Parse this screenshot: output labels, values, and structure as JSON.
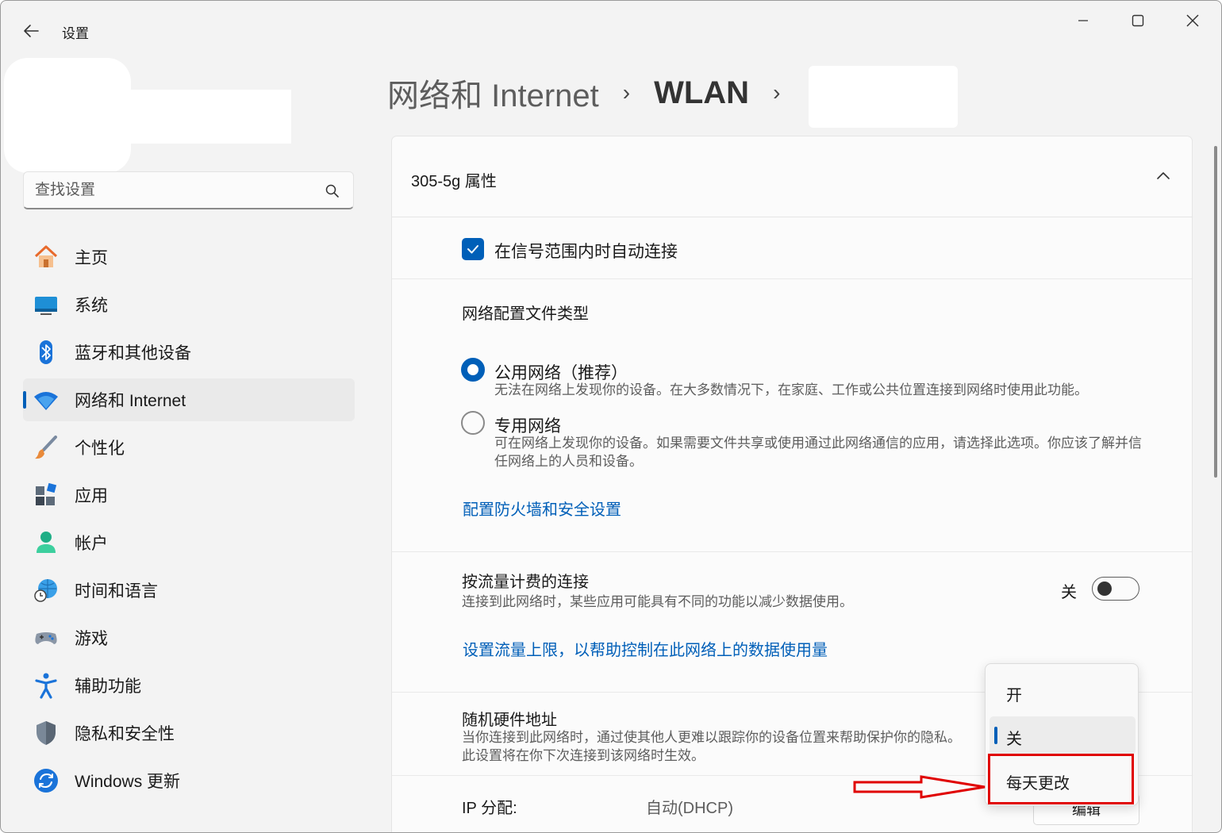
{
  "window": {
    "title": "设置"
  },
  "search": {
    "placeholder": "查找设置"
  },
  "sidebar": {
    "items": [
      {
        "label": "主页",
        "icon": "home-icon"
      },
      {
        "label": "系统",
        "icon": "system-icon"
      },
      {
        "label": "蓝牙和其他设备",
        "icon": "bluetooth-icon"
      },
      {
        "label": "网络和 Internet",
        "icon": "wifi-icon"
      },
      {
        "label": "个性化",
        "icon": "brush-icon"
      },
      {
        "label": "应用",
        "icon": "apps-icon"
      },
      {
        "label": "帐户",
        "icon": "account-icon"
      },
      {
        "label": "时间和语言",
        "icon": "time-language-icon"
      },
      {
        "label": "游戏",
        "icon": "gamepad-icon"
      },
      {
        "label": "辅助功能",
        "icon": "accessibility-icon"
      },
      {
        "label": "隐私和安全性",
        "icon": "shield-icon"
      },
      {
        "label": "Windows 更新",
        "icon": "update-icon"
      }
    ],
    "active_index": 3
  },
  "breadcrumb": {
    "parent": "网络和 Internet",
    "middle": "WLAN",
    "separator": "›"
  },
  "properties": {
    "title": "305-5g 属性",
    "auto_connect": {
      "label": "在信号范围内时自动连接",
      "checked": true
    },
    "profile": {
      "title": "网络配置文件类型",
      "public": {
        "label": "公用网络（推荐）",
        "desc": "无法在网络上发现你的设备。在大多数情况下，在家庭、工作或公共位置连接到网络时使用此功能。",
        "selected": true
      },
      "private": {
        "label": "专用网络",
        "desc": "可在网络上发现你的设备。如果需要文件共享或使用通过此网络通信的应用，请选择此选项。你应该了解并信任网络上的人员和设备。",
        "selected": false
      },
      "firewall_link": "配置防火墙和安全设置"
    },
    "metered": {
      "title": "按流量计费的连接",
      "desc": "连接到此网络时，某些应用可能具有不同的功能以减少数据使用。",
      "toggle_label": "关",
      "toggle_on": false,
      "limit_link": "设置流量上限，以帮助控制在此网络上的数据使用量"
    },
    "random_hw": {
      "title": "随机硬件地址",
      "desc": "当你连接到此网络时，通过使其他人更难以跟踪你的设备位置来帮助保护你的隐私。此设置将在你下次连接到该网络时生效。"
    },
    "ip": {
      "label": "IP 分配:",
      "value": "自动(DHCP)",
      "edit_label": "编辑"
    }
  },
  "dropdown": {
    "options": [
      "开",
      "关",
      "每天更改"
    ],
    "selected": "关",
    "highlighted": "每天更改"
  },
  "colors": {
    "accent": "#005fb8",
    "annotation": "#e00000"
  }
}
